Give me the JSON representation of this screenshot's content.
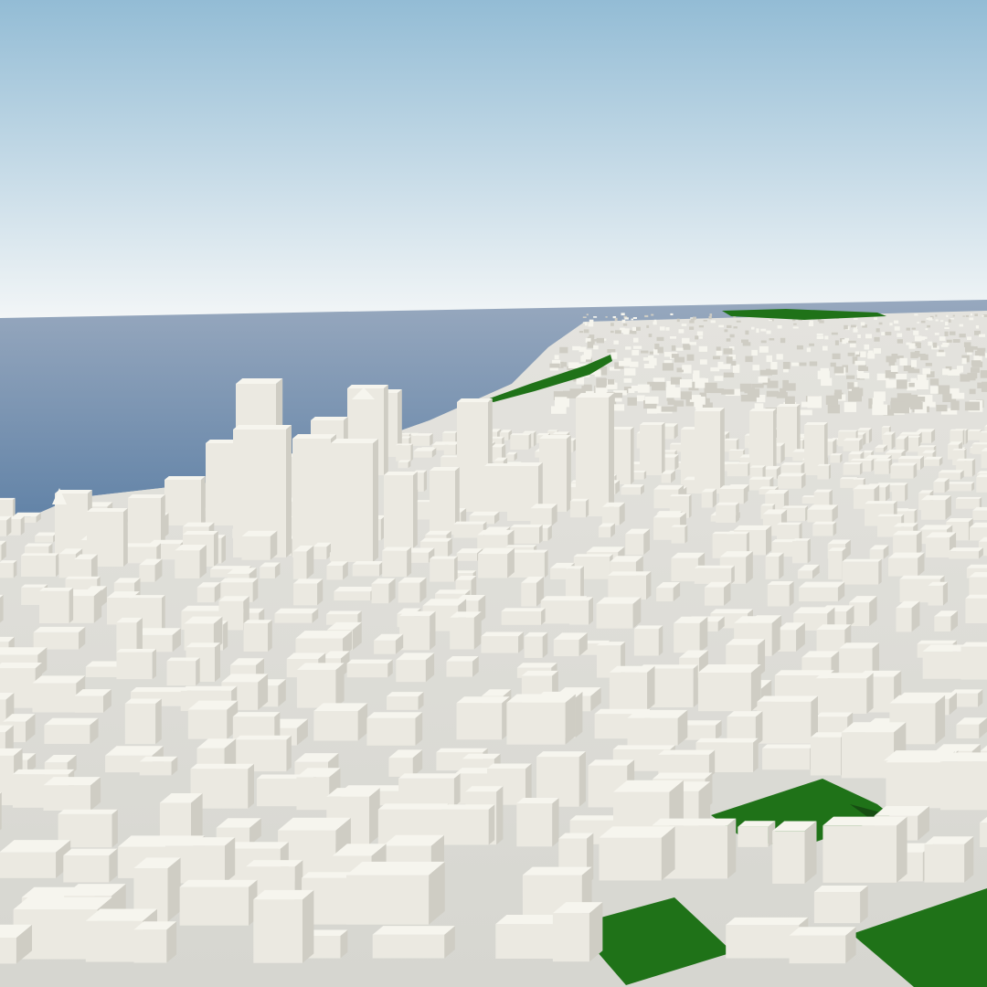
{
  "scene": {
    "kind": "3d-city-model-render",
    "colors": {
      "sky_top": "#93bcd5",
      "sky_horizon": "#f3f6f7",
      "sea_far": "#97a8be",
      "sea_near": "#5f81a6",
      "ground": "#dcdcd6",
      "building_top": "#f6f5ee",
      "building_lit": "#ebe9e1",
      "building_shade": "#cfcdc4",
      "park": "#1f7218",
      "park_dark": "#164d12"
    },
    "parks": [
      {
        "name": "park-right-mid"
      },
      {
        "name": "park-bottom-center"
      },
      {
        "name": "park-bottom-right"
      },
      {
        "name": "park-coastline-strip"
      }
    ]
  }
}
